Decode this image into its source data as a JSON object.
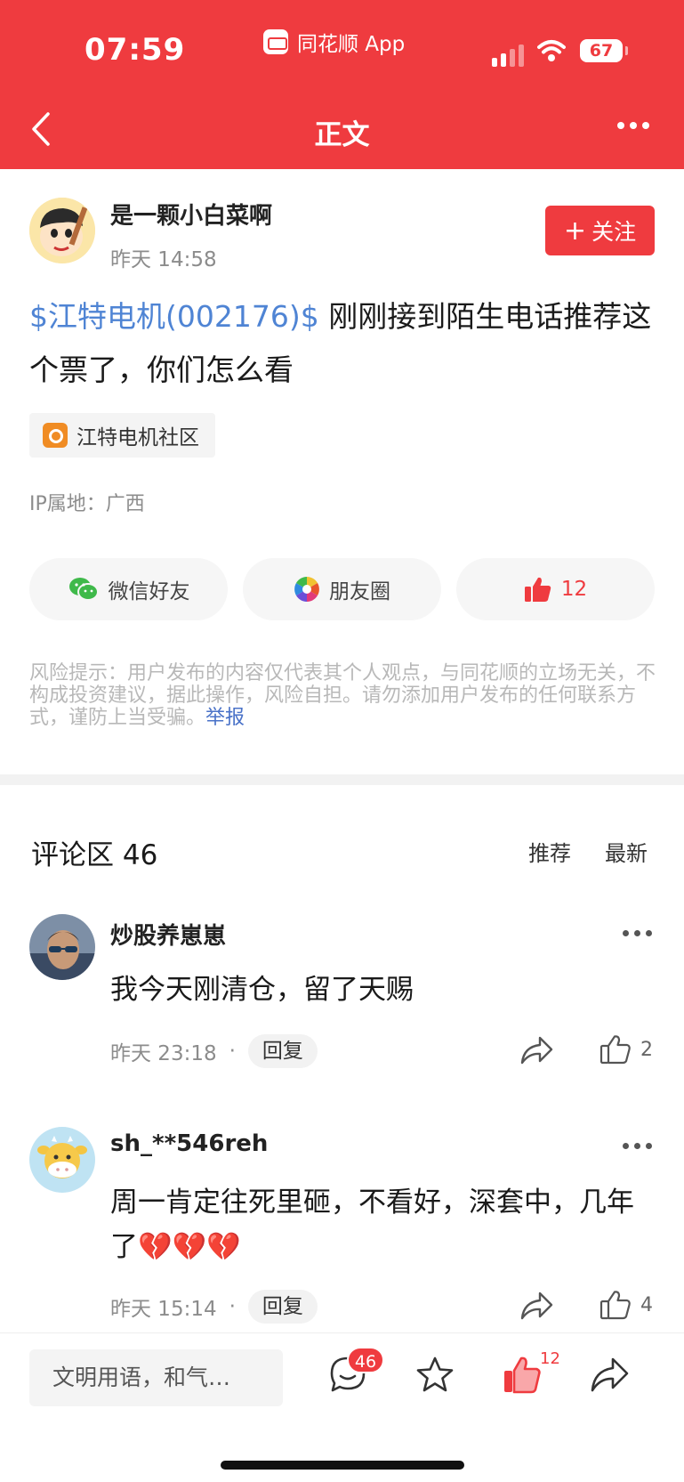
{
  "status_bar": {
    "time": "07:59",
    "app_name": "同花顺 App",
    "battery": "67"
  },
  "nav": {
    "title": "正文"
  },
  "post": {
    "author": "是一颗小白菜啊",
    "time": "昨天 14:58",
    "follow_label": "关注",
    "stock_tag": "$江特电机(002176)$",
    "text": " 刚刚接到陌生电话推荐这个票了，你们怎么看",
    "community": "江特电机社区",
    "ip": "IP属地：广西",
    "share_wechat": "微信好友",
    "share_moments": "朋友圈",
    "like_count": "12",
    "risk_notice": "风险提示：用户发布的内容仅代表其个人观点，与同花顺的立场无关，不构成投资建议，据此操作，风险自担。请勿添加用户发布的任何联系方式，谨防上当受骗。",
    "report_label": "举报"
  },
  "comments_header": {
    "title": "评论区 46",
    "sort_recommended": "推荐",
    "sort_latest": "最新"
  },
  "comments": [
    {
      "name": "炒股养崽崽",
      "text": "我今天刚清仓，留了天赐",
      "time": "昨天 23:18",
      "reply": "回复",
      "likes": "2"
    },
    {
      "name": "sh_**546reh",
      "text": "周一肯定往死里砸，不看好，深套中，几年了💔💔💔",
      "time": "昨天 15:14",
      "reply": "回复",
      "likes": "4"
    }
  ],
  "bottom_bar": {
    "input_placeholder": "文明用语，和气…",
    "comment_badge": "46",
    "like_count": "12"
  },
  "colors": {
    "brand_red": "#ef3b3f",
    "stock_blue": "#4f84d4",
    "report_blue": "#4a72c8"
  }
}
